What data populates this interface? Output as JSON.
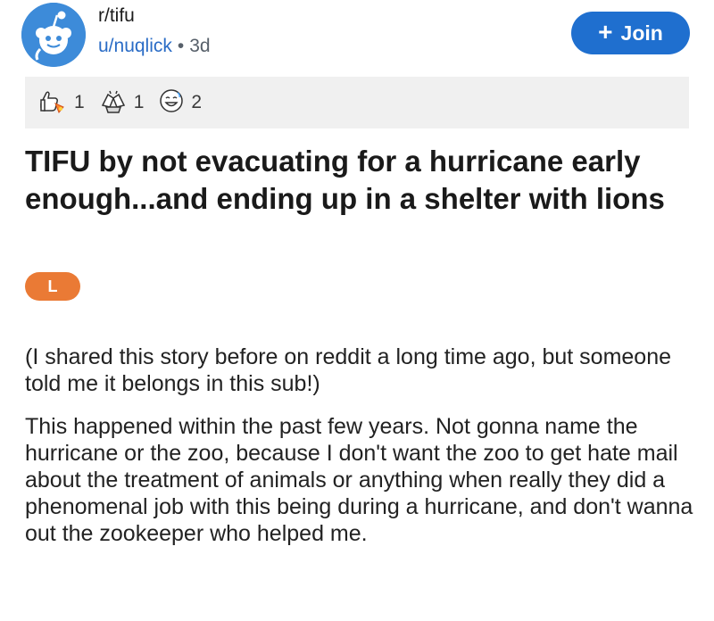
{
  "header": {
    "subreddit": "r/tifu",
    "username": "u/nuqlick",
    "separator": "•",
    "age": "3d",
    "join_label": "Join",
    "join_icon": "plus-icon"
  },
  "awards": [
    {
      "icon": "rocket-like-award-icon",
      "count": "1"
    },
    {
      "icon": "bravo-award-icon",
      "count": "1"
    },
    {
      "icon": "laughing-face-award-icon",
      "count": "2"
    }
  ],
  "post": {
    "title": "TIFU by not evacuating for a hurricane early enough...and ending up in a shelter with lions",
    "flair": "L",
    "paragraphs": [
      "(I shared this story before on reddit a long time ago, but someone told me it belongs in this sub!)",
      "This happened within the past few years. Not gonna name the hurricane or the zoo, because I don't want the zoo to get hate mail about the treatment of animals or anything when really they did a phenomenal job with this being during a hurricane, and don't wanna out the zookeeper who helped me."
    ]
  },
  "colors": {
    "join_button": "#1f6fcf",
    "username": "#2a6cc6",
    "flair": "#ea7a35",
    "avatar": "#3d8bd9",
    "awards_bar": "#f0f0f0"
  }
}
